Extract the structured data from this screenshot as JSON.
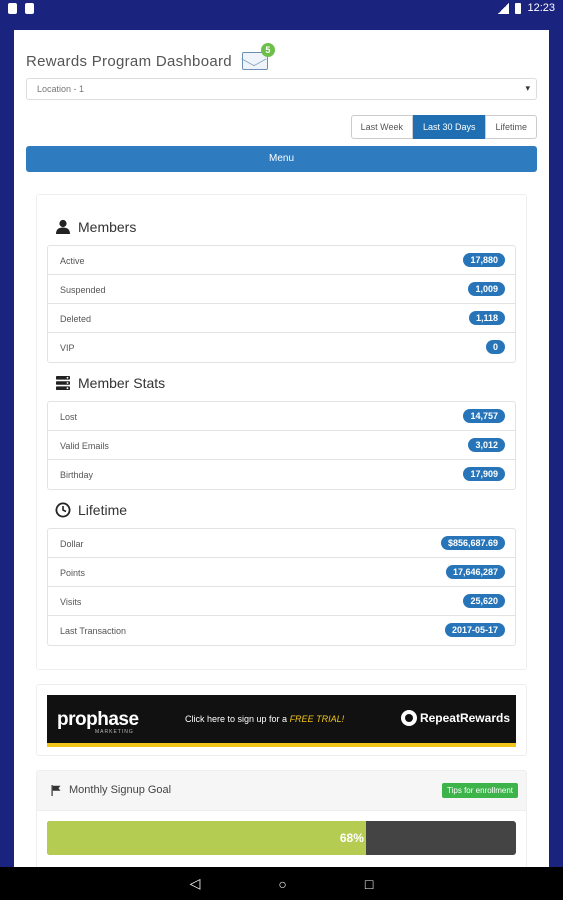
{
  "statusbar": {
    "time": "12:23"
  },
  "header": {
    "title": "Rewards Program Dashboard",
    "message_count": "5"
  },
  "location": {
    "selected": "Location - 1"
  },
  "range": {
    "options": [
      "Last Week",
      "Last 30 Days",
      "Lifetime"
    ],
    "active": "Last 30 Days"
  },
  "menu": {
    "label": "Menu"
  },
  "members": {
    "title": "Members",
    "rows": [
      {
        "label": "Active",
        "value": "17,880"
      },
      {
        "label": "Suspended",
        "value": "1,009"
      },
      {
        "label": "Deleted",
        "value": "1,118"
      },
      {
        "label": "VIP",
        "value": "0"
      }
    ]
  },
  "member_stats": {
    "title": "Member Stats",
    "rows": [
      {
        "label": "Lost",
        "value": "14,757"
      },
      {
        "label": "Valid Emails",
        "value": "3,012"
      },
      {
        "label": "Birthday",
        "value": "17,909"
      }
    ]
  },
  "lifetime": {
    "title": "Lifetime",
    "rows": [
      {
        "label": "Dollar",
        "value": "$856,687.69"
      },
      {
        "label": "Points",
        "value": "17,646,287"
      },
      {
        "label": "Visits",
        "value": "25,620"
      },
      {
        "label": "Last Transaction",
        "value": "2017-05-17"
      }
    ]
  },
  "banner": {
    "brand": "prophase",
    "brand_sub": "MARKETING",
    "cta_prefix": "Click here to sign up for a ",
    "cta_highlight": "FREE TRIAL!",
    "partner": "RepeatRewards",
    "accent_color": "#f0c419"
  },
  "goal": {
    "title": "Monthly Signup Goal",
    "tips_label": "Tips for enrollment",
    "progress_percent": 68,
    "progress_label": "68%",
    "fill_color": "#b5cc52"
  },
  "colors": {
    "primary": "#1f6fb2",
    "app_bar": "#1a237e",
    "badge": "#2775b8"
  }
}
